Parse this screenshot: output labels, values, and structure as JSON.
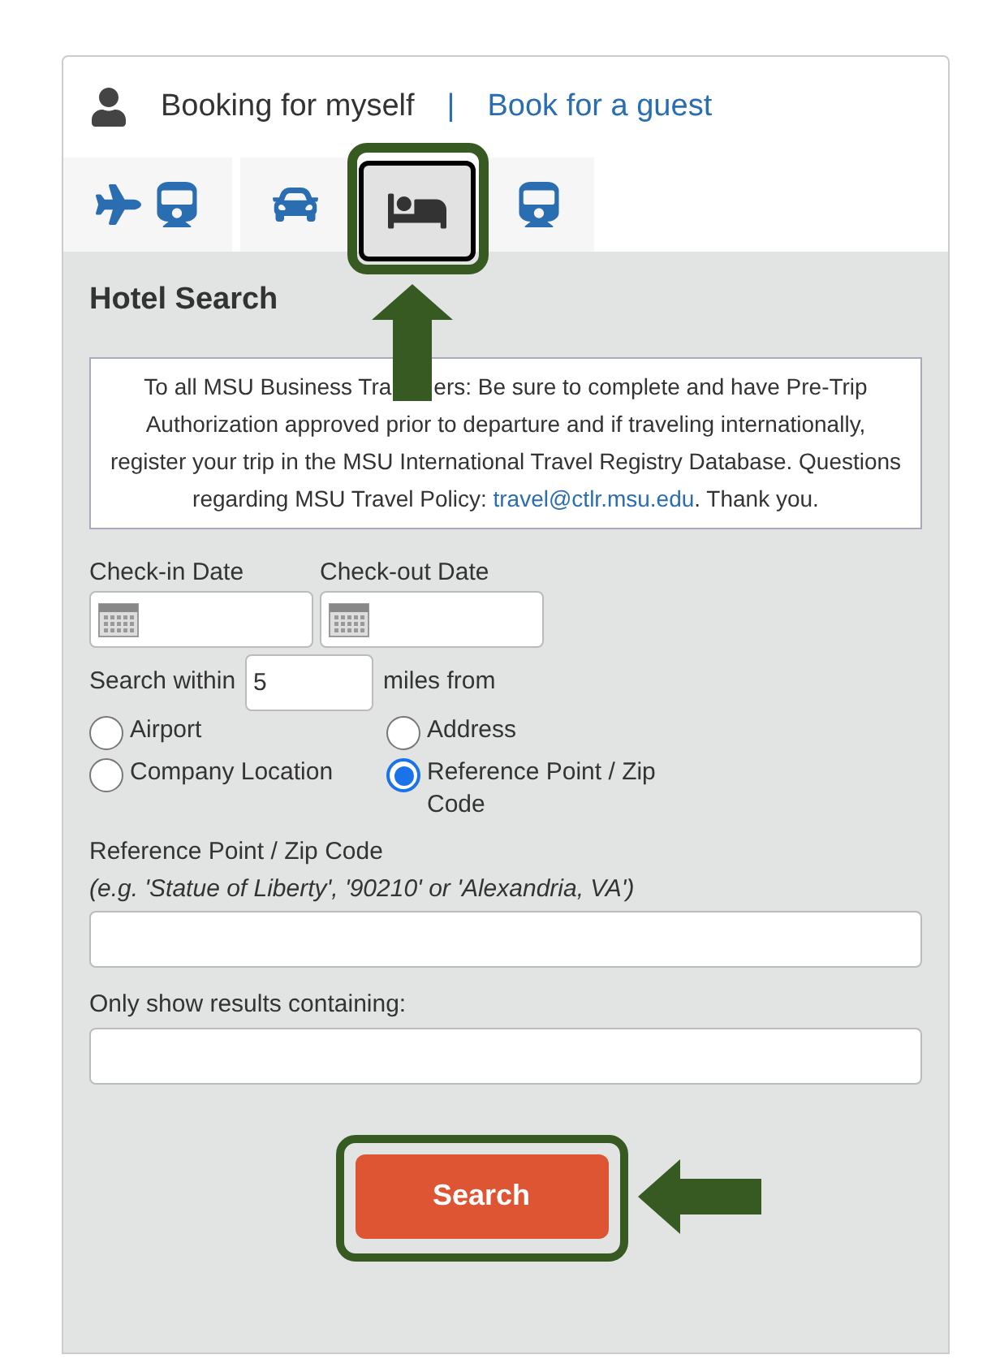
{
  "booking": {
    "self_label": "Booking for myself",
    "separator": "|",
    "guest_link": "Book for a guest"
  },
  "tabs": [
    {
      "kind": "air_rail",
      "selected": false
    },
    {
      "kind": "car",
      "selected": false
    },
    {
      "kind": "hotel",
      "selected": true
    },
    {
      "kind": "rail",
      "selected": false
    }
  ],
  "panel": {
    "title": "Hotel Search",
    "notice": {
      "text_before_arrow": "To all MSU Business Tra",
      "text": "ers: Be sure to complete and have Pre-Trip Authorization approved prior to departure and if traveling internationally, register your trip in the MSU International Travel Registry Database. Questions regarding MSU Travel Policy: ",
      "link": "travel@ctlr.msu.edu",
      "after": ". Thank you."
    },
    "checkin_label": "Check-in Date",
    "checkout_label": "Check-out Date",
    "within_label": "Search within",
    "within_value": "5",
    "miles_label": "miles from",
    "radios": [
      {
        "label": "Airport",
        "selected": false
      },
      {
        "label": "Address",
        "selected": false
      },
      {
        "label": "Company Location",
        "selected": false
      },
      {
        "label": "Reference Point / Zip Code",
        "selected": true
      }
    ],
    "ref_label": "Reference Point / Zip Code",
    "ref_hint": "(e.g. 'Statue of Liberty', '90210' or 'Alexandria, VA')",
    "filter_label": "Only show results containing:",
    "search_button": "Search"
  }
}
